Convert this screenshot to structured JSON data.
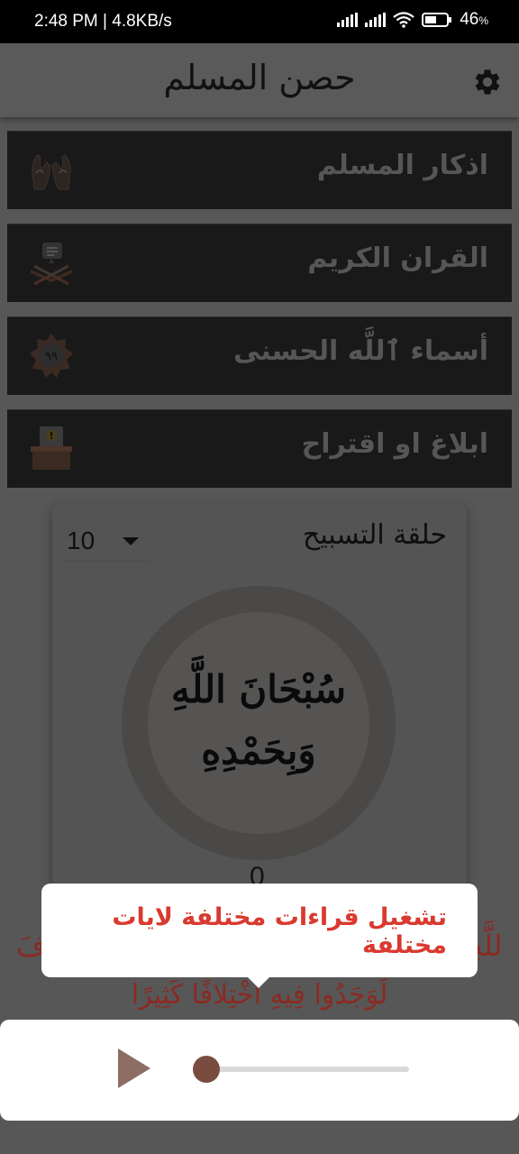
{
  "status": {
    "time": "2:48 PM | 4.8KB/s",
    "battery": "46"
  },
  "app": {
    "title": "حصن المسلم"
  },
  "menu": [
    {
      "label": "اذكار المسلم",
      "icon": "praying-hands-icon"
    },
    {
      "label": "القران الكريم",
      "icon": "quran-icon"
    },
    {
      "label": "أسماء ٱللَّه الحسنى",
      "icon": "ninety-nine-names-icon",
      "badge": "٩٩"
    },
    {
      "label": "ابلاغ او اقتراح",
      "icon": "report-box-icon"
    }
  ],
  "tasbeeh": {
    "title": "حلقة التسبيح",
    "count_option": "10",
    "dhikr_line1": "سُبْحَانَ اللَّهِ",
    "dhikr_line2": "وَبِحَمْدِهِ",
    "counter": "0"
  },
  "verse": {
    "line1_start": "أَفَ",
    "line1_end": "للَّهِ",
    "line2": "لَوَجَدُوا فِيهِ اخْتِلافًا كَثِيرًا"
  },
  "tooltip": {
    "text": "تشغيل قراءات مختلفة لايات مختلفة"
  },
  "player": {
    "progress": 0.0
  },
  "colors": {
    "accent": "#8d6e63",
    "tooltip_text": "#d93a2f",
    "verse_text": "#8a2a22"
  }
}
